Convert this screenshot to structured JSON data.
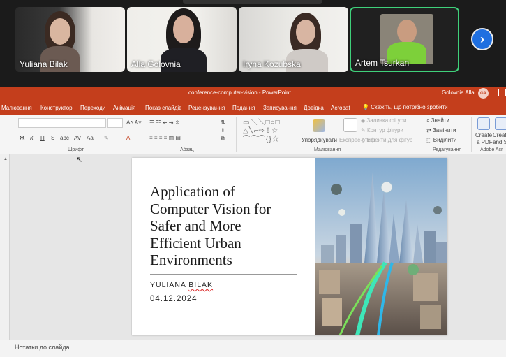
{
  "participants": [
    {
      "name": "Yuliana Bilak",
      "active": false
    },
    {
      "name": "Alla Golovnia",
      "active": false
    },
    {
      "name": "Iryna Kozubska",
      "active": false
    },
    {
      "name": "Artem Tsurkan",
      "active": true
    }
  ],
  "next_icon": "chevron-right-icon",
  "powerpoint": {
    "document_title": "conference-computer-vision  -  PowerPoint",
    "user_name": "Golovnia Alla",
    "user_initials": "GA",
    "tabs": [
      "Малювання",
      "Конструктор",
      "Переходи",
      "Анімація",
      "Показ слайдів",
      "Рецензування",
      "Подання",
      "Записування",
      "Довідка",
      "Acrobat"
    ],
    "tell_me": "Скажіть, що потрібно зробити",
    "ribbon": {
      "font_group": "Шрифт",
      "paragraph_group": "Абзац",
      "drawing_group": "Малювання",
      "editing_group": "Редагування",
      "acrobat_group": "Adobe Acr",
      "arrange": "Упорядкувати",
      "quick_styles": "Експрес-стилі",
      "shape_fill": "Заливка фігури",
      "shape_outline": "Контур фігури",
      "shape_effects": "Ефекти для фігур",
      "find": "Знайти",
      "replace": "Замінити",
      "select": "Виділити",
      "create_pdf_1": "Create",
      "create_pdf_2": "a PDF",
      "create_share_1": "Creat",
      "create_share_2": "and S"
    },
    "notes_label": "Нотатки до слайда"
  },
  "slide": {
    "title_lines": [
      "Application of",
      "Computer Vision for",
      "Safer and More",
      "Efficient Urban",
      "Environments"
    ],
    "author_first": "YULIANA",
    "author_last": "BILAK",
    "date": "04.12.2024"
  },
  "colors": {
    "ppt_accent": "#c43e1c",
    "active_speaker_border": "#3fd07a",
    "next_button": "#1f6fe0"
  }
}
